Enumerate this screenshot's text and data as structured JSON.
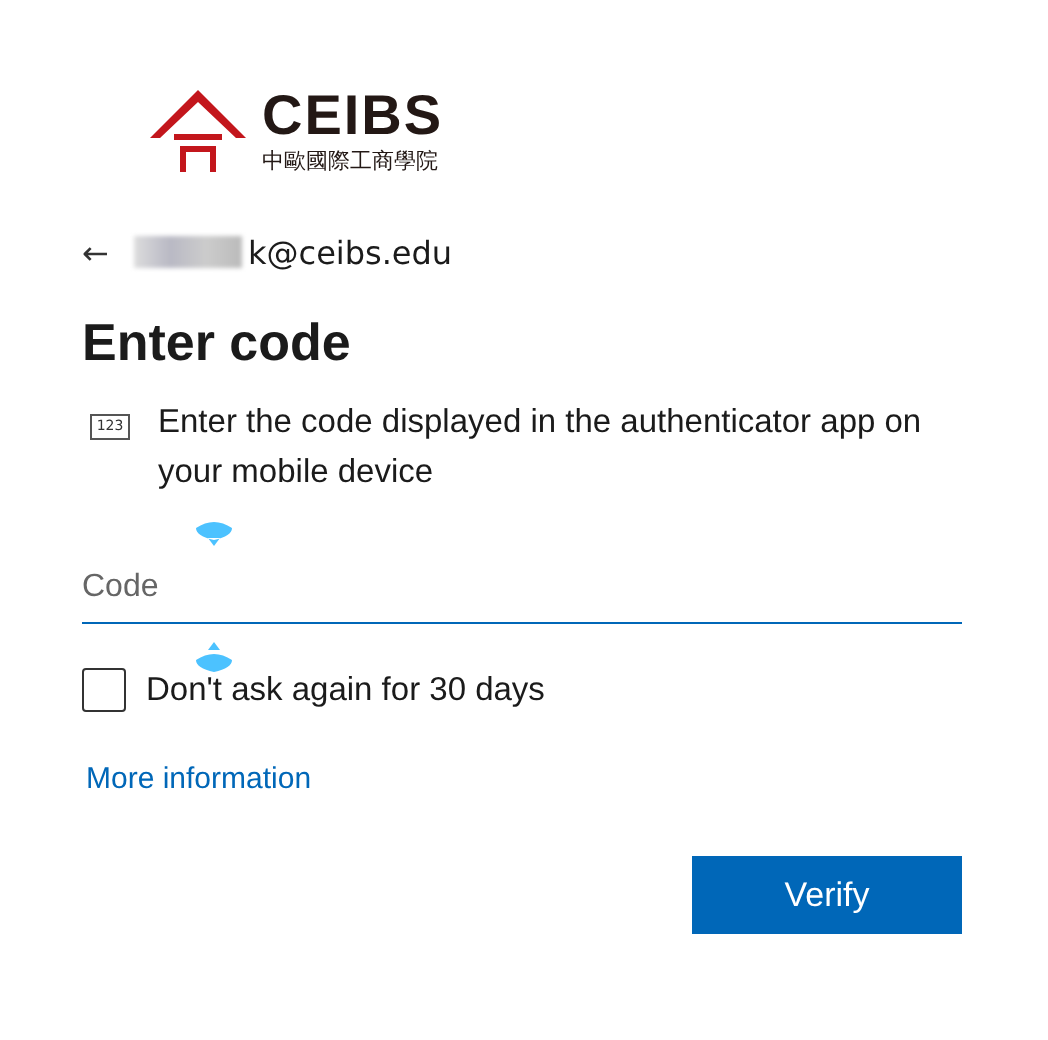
{
  "logo": {
    "name": "CEIBS",
    "subtitle": "中歐國際工商學院"
  },
  "identity": {
    "back": "←",
    "email": "k@ceibs.edu",
    "redacted": true
  },
  "title": "Enter code",
  "instruction": {
    "icon_text": "123",
    "text": "Enter the code displayed in the authenticator app on your mobile device"
  },
  "code_field": {
    "placeholder": "Code",
    "focused": true
  },
  "remember": {
    "label": "Don't ask again for 30 days",
    "checked": false
  },
  "link": "More information",
  "buttons": [
    {
      "label": "Verify",
      "kind": "primary"
    }
  ]
}
